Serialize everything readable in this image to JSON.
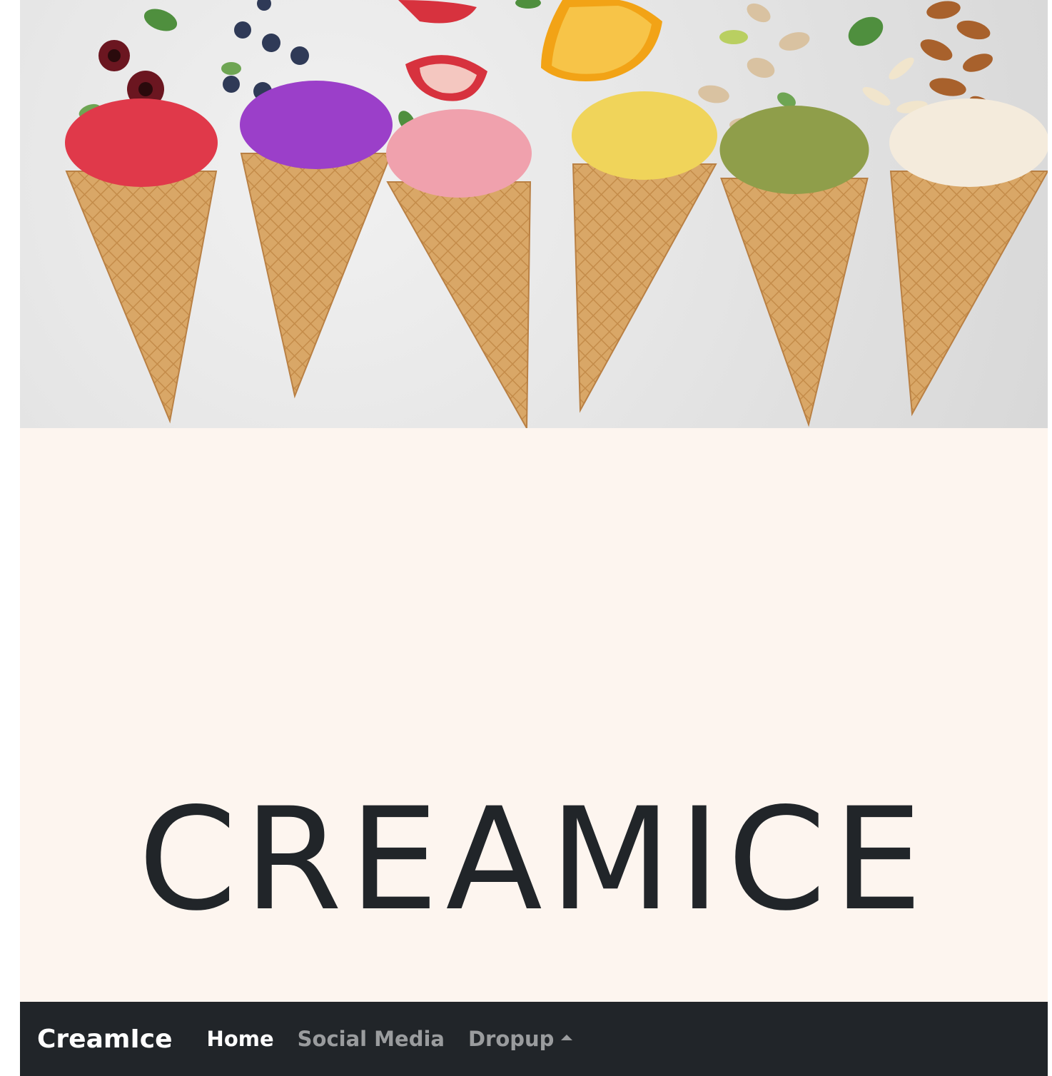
{
  "hero": {
    "image_alt": "Ice cream cones with berries, citrus, pistachios and almonds",
    "scoops": [
      {
        "flavor": "cherry",
        "color": "#e0394a"
      },
      {
        "flavor": "blueberry",
        "color": "#9b3fc9"
      },
      {
        "flavor": "strawberry",
        "color": "#f0a1ad"
      },
      {
        "flavor": "mango",
        "color": "#f0d45a"
      },
      {
        "flavor": "pistachio",
        "color": "#8f9e4a"
      },
      {
        "flavor": "almond",
        "color": "#f4ebdc"
      }
    ]
  },
  "main": {
    "title": "CREAMICE"
  },
  "navbar": {
    "brand": "CreamIce",
    "links": [
      {
        "label": "Home",
        "active": true
      },
      {
        "label": "Social Media",
        "active": false
      },
      {
        "label": "Dropup",
        "active": false,
        "dropdown": true
      }
    ]
  },
  "colors": {
    "page_background": "#fdf5ef",
    "navbar_background": "#212529",
    "title_color": "#212529",
    "cone": "#d9a767"
  }
}
